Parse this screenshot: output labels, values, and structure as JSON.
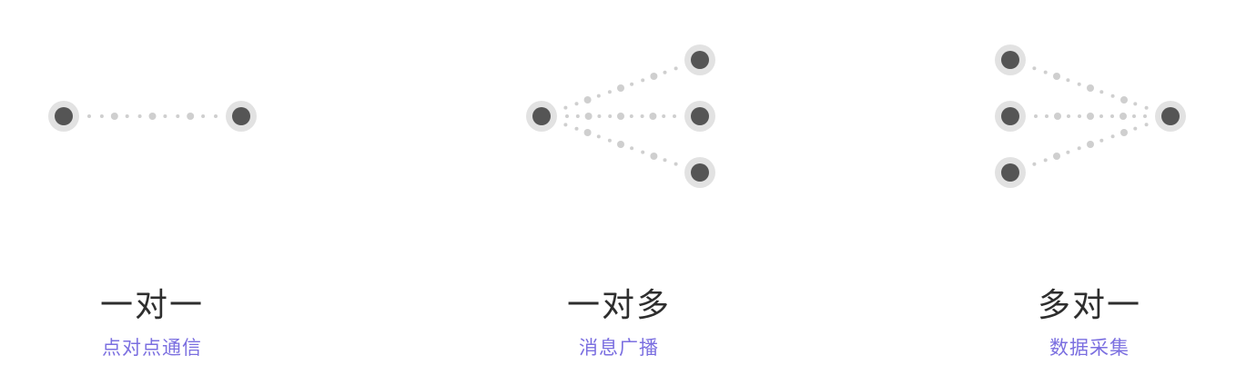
{
  "patterns": [
    {
      "title": "一对一",
      "subtitle": "点对点通信",
      "sources": 1,
      "targets": 1
    },
    {
      "title": "一对多",
      "subtitle": "消息广播",
      "sources": 1,
      "targets": 3
    },
    {
      "title": "多对一",
      "subtitle": "数据采集",
      "sources": 3,
      "targets": 1
    }
  ],
  "colors": {
    "node_core": "#555555",
    "node_halo": "#e2e2e2",
    "dot": "#cfcfcf",
    "title": "#2e2e2e",
    "subtitle": "#7b6fe0"
  },
  "icons": {
    "node": "circle-node-icon",
    "link": "dotted-link-icon"
  }
}
